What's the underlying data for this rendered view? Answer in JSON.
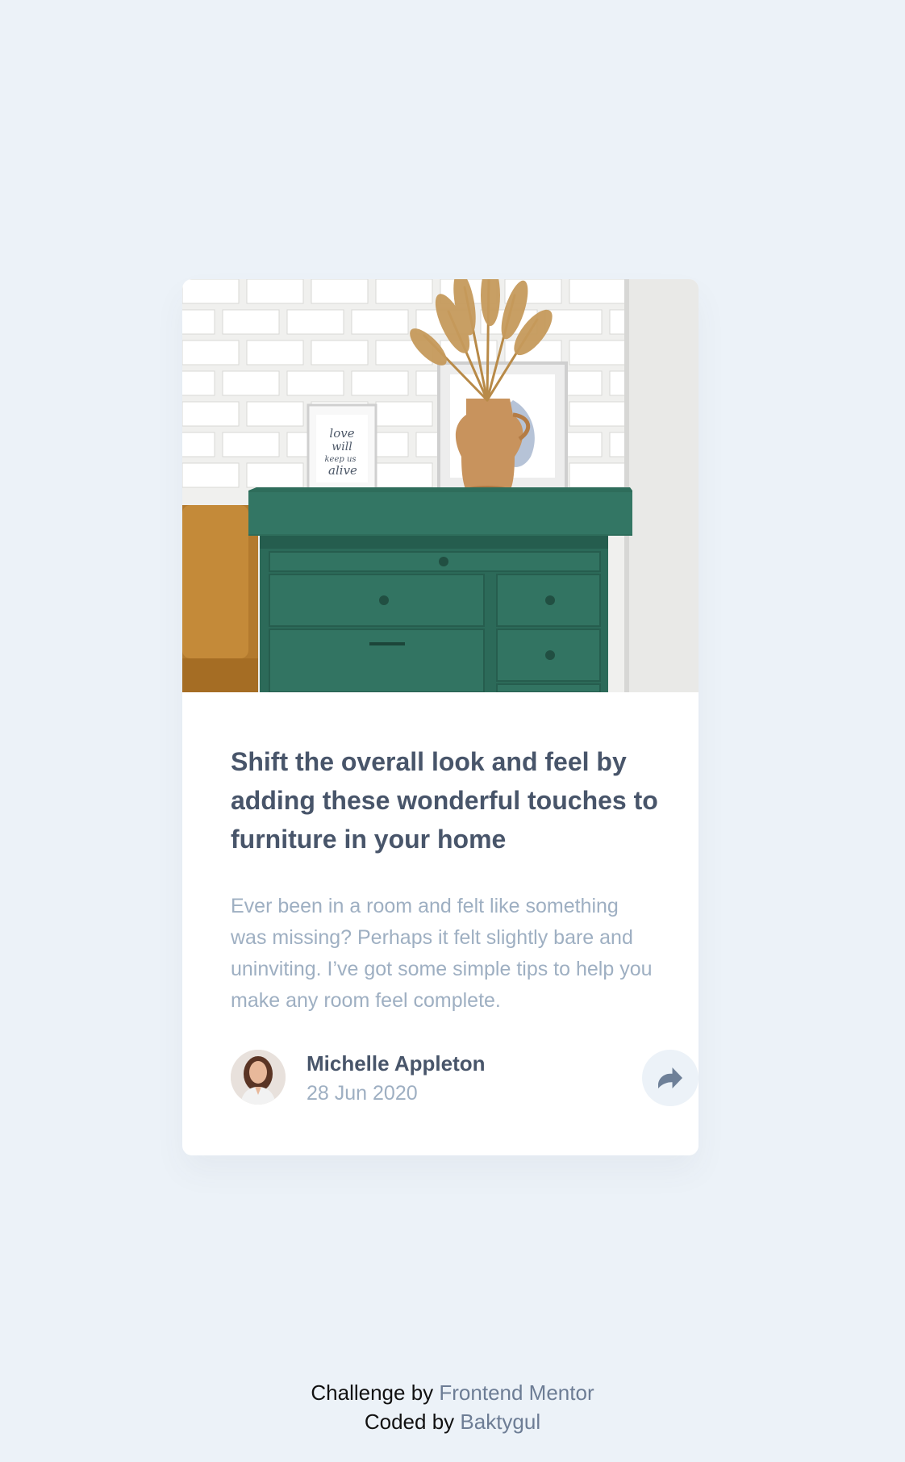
{
  "card": {
    "image_alt": "Green drawer with vase and framed prints",
    "frame_text": [
      "love",
      "will",
      "keep us",
      "alive"
    ],
    "title": "Shift the overall look and feel by adding these wonderful touches to furniture in your home",
    "description": "Ever been in a room and felt like something was missing? Perhaps it felt slightly bare and uninviting. I’ve got some simple tips to help you make any room feel complete.",
    "author": {
      "name": "Michelle Appleton",
      "date": "28 Jun 2020",
      "avatar_icon": "avatar-photo"
    },
    "share": {
      "icon": "share-icon",
      "label": "Share"
    }
  },
  "attribution": {
    "line1_prefix": "Challenge by",
    "line1_link": "Frontend Mentor",
    "line2_prefix": "Coded by",
    "line2_link": "Baktygul"
  },
  "colors": {
    "page_background": "#ecf2f8",
    "card_background": "#ffffff",
    "title": "#48556a",
    "muted_text": "#9eafc2",
    "link": "#6d7d95",
    "share_button_background": "#ecf2f8"
  }
}
